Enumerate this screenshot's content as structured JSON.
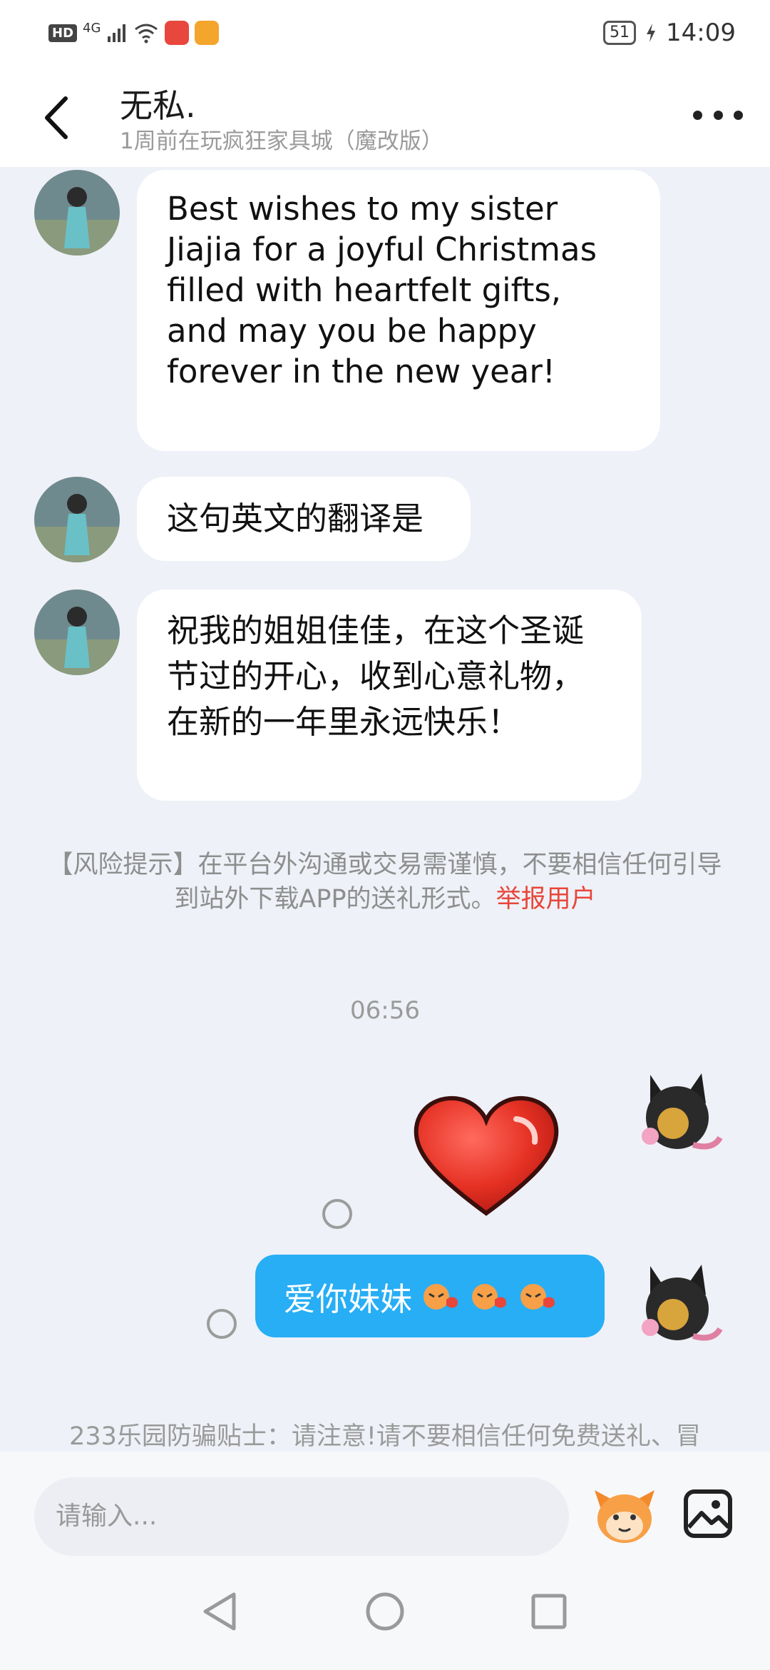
{
  "status_bar": {
    "hd_label": "HD",
    "network_label": "4G",
    "battery_level": "51",
    "time": "14:09"
  },
  "header": {
    "title": "无私.",
    "subtitle": "1周前在玩疯狂家具城（魔改版）"
  },
  "messages": {
    "m1": "Best wishes to my sister Jiajia for a joyful Christmas filled with heartfelt gifts, and may you be happy forever in the new year!",
    "m2": "这句英文的翻译是",
    "m3": "祝我的姐姐佳佳，在这个圣诞节过的开心，收到心意礼物，在新的一年里永远快乐！"
  },
  "risk_tip": {
    "text": "【风险提示】在平台外沟通或交易需谨慎，不要相信任何引导到站外下载APP的送礼形式。",
    "report_link": "举报用户"
  },
  "timestamp": "06:56",
  "my_messages": {
    "love_text": "爱你妹妹"
  },
  "anti_fraud_tip": "233乐园防骗贴士：请注意!请不要相信任何免费送礼、冒",
  "input": {
    "placeholder": "请输入..."
  },
  "colors": {
    "accent_blue": "#27aef5",
    "report_red": "#e8463a",
    "background": "#eef1f7"
  },
  "icons": [
    "back-arrow-icon",
    "more-dots-icon",
    "heart-sticker-icon",
    "emoji-icon",
    "image-icon",
    "nav-back-icon",
    "nav-home-icon",
    "nav-recent-icon"
  ]
}
